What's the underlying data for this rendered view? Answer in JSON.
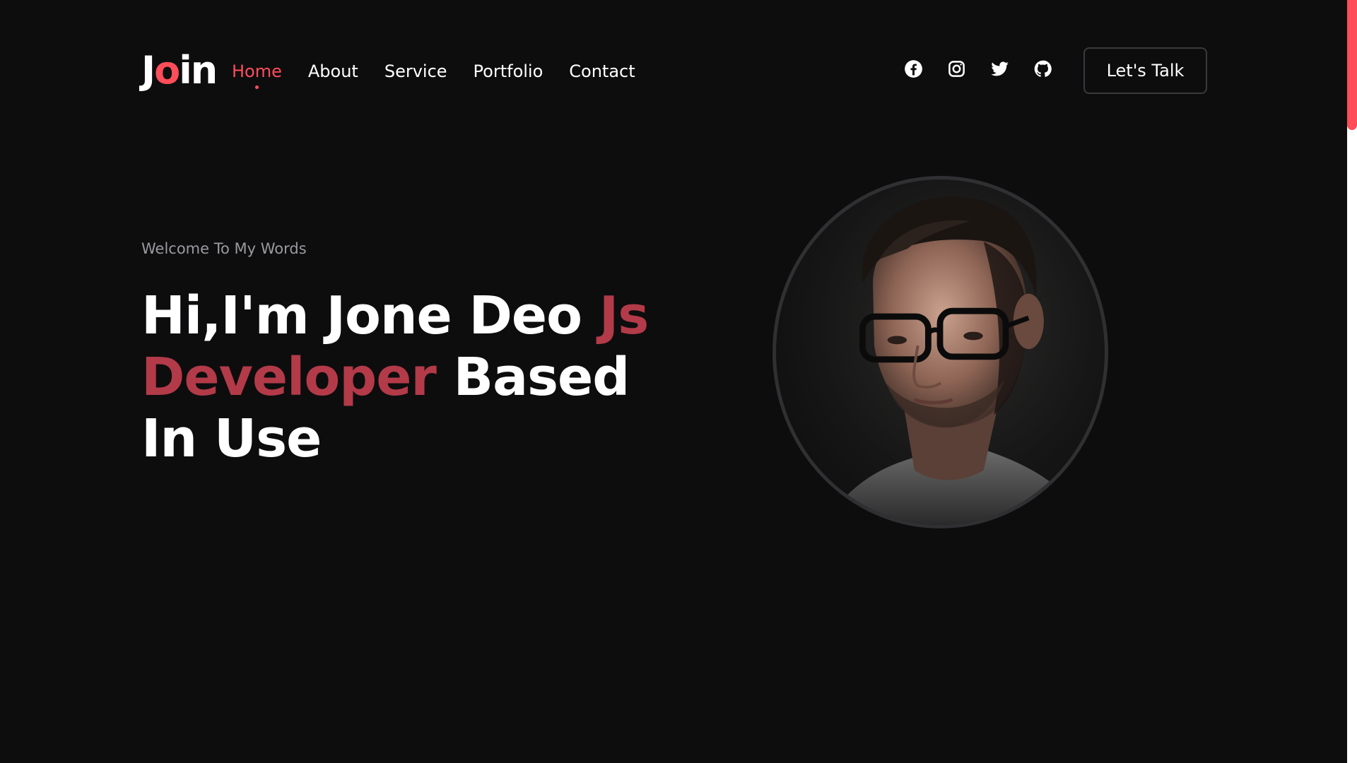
{
  "logo": {
    "prefix": "J",
    "accent": "o",
    "suffix": "in"
  },
  "nav": [
    {
      "label": "Home",
      "active": true
    },
    {
      "label": "About"
    },
    {
      "label": "Service"
    },
    {
      "label": "Portfolio"
    },
    {
      "label": "Contact"
    }
  ],
  "socials": [
    {
      "icon": "facebook-icon"
    },
    {
      "icon": "instagram-icon"
    },
    {
      "icon": "twitter-icon"
    },
    {
      "icon": "github-icon"
    }
  ],
  "cta": {
    "label": "Let's Talk"
  },
  "hero": {
    "welcome": "Welcome To My Words",
    "headline_part1": "Hi,I'm Jone Deo ",
    "headline_highlight": "Js Developer",
    "headline_part2": " Based In Use"
  },
  "colors": {
    "background": "#0d0d0e",
    "accent": "#ff4d5a",
    "headline_highlight": "#b33a48",
    "muted_text": "#9a9a9f"
  }
}
